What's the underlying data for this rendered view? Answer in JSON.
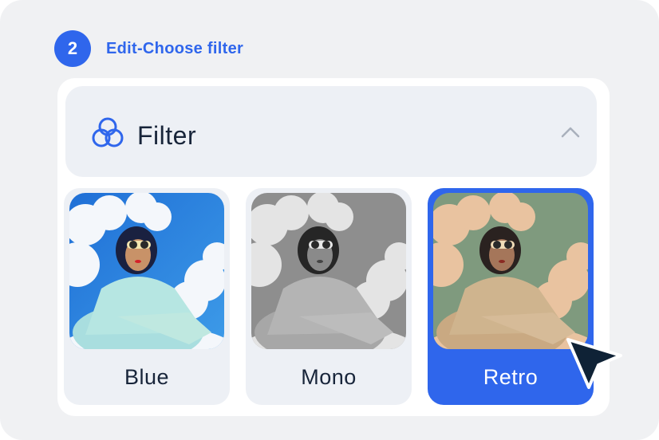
{
  "step": {
    "number": "2",
    "title": "Edit-Choose filter"
  },
  "panel": {
    "title": "Filter",
    "icon": "filter-circles-icon",
    "toggle_icon": "chevron-up-icon",
    "expanded": true
  },
  "filters": [
    {
      "label": "Blue",
      "selected": false
    },
    {
      "label": "Mono",
      "selected": false
    },
    {
      "label": "Retro",
      "selected": true
    }
  ],
  "colors": {
    "accent": "#2f66ec",
    "text": "#18253a",
    "card_bg": "#edf0f5",
    "page_bg": "#f0f1f3"
  },
  "cursor_icon": "mouse-pointer-icon"
}
